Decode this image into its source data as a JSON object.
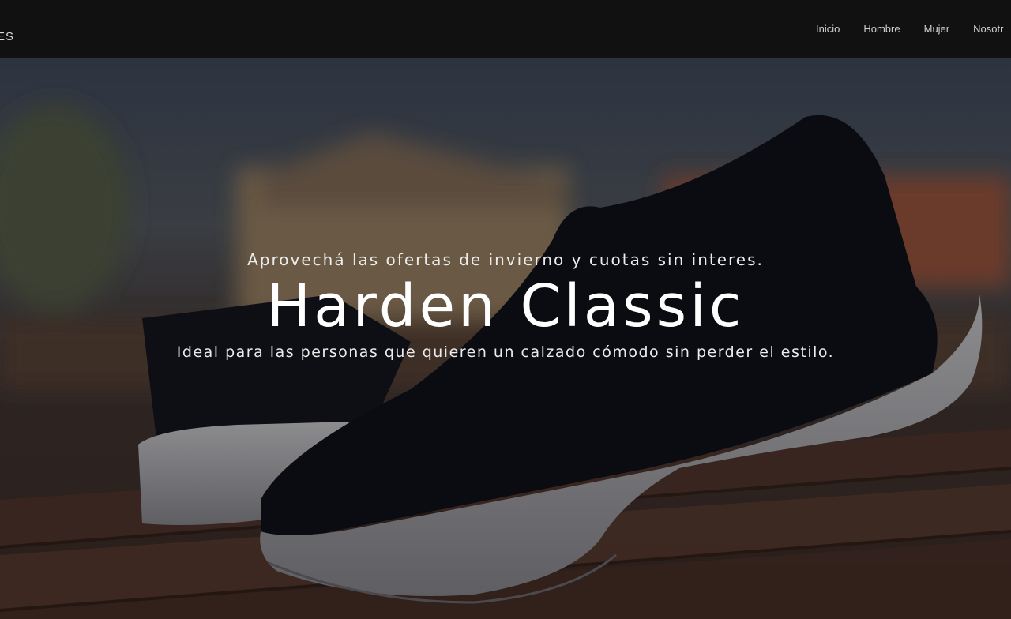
{
  "header": {
    "brand": "ES",
    "nav": [
      "Inicio",
      "Hombre",
      "Mujer",
      "Nosotr"
    ]
  },
  "hero": {
    "subtitle": "Aprovechá las ofertas de invierno y cuotas sin interes.",
    "title": "Harden Classic",
    "description": "Ideal para las personas que quieren un calzado cómodo sin perder el estilo."
  },
  "colors": {
    "topbar": "#111111",
    "nav_text": "#cfcfcf",
    "hero_text": "#ffffff"
  }
}
